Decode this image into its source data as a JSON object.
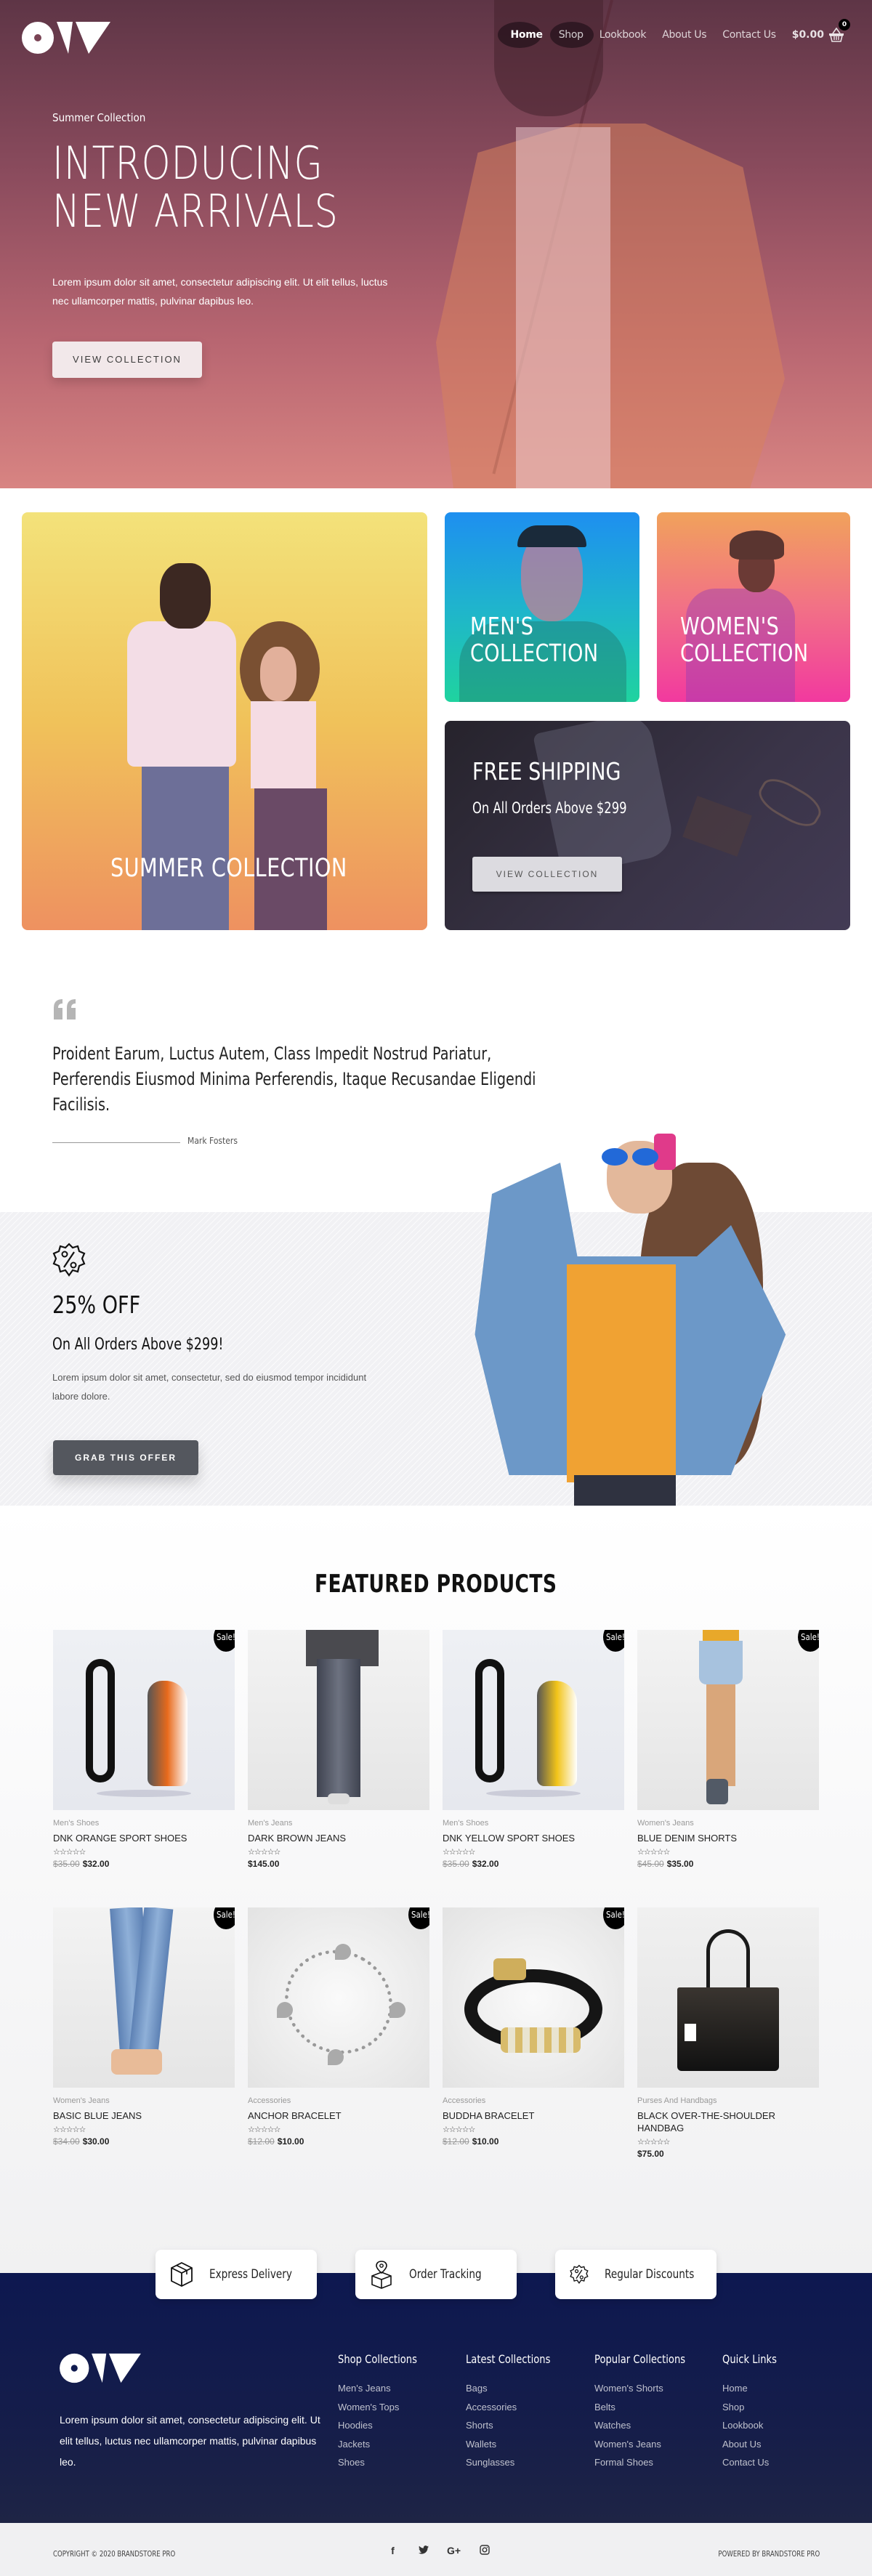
{
  "nav": {
    "logo_alt": "OW",
    "links": [
      {
        "label": "Home",
        "active": true
      },
      {
        "label": "Shop",
        "active": false
      },
      {
        "label": "Lookbook",
        "active": false
      },
      {
        "label": "About Us",
        "active": false
      },
      {
        "label": "Contact Us",
        "active": false
      }
    ],
    "cart_total": "$0.00",
    "cart_count": "0",
    "cart_icon": "basket-icon"
  },
  "hero": {
    "eyebrow": "Summer Collection",
    "title_line1": "INTRODUCING",
    "title_line2": "NEW ARRIVALS",
    "description": "Lorem ipsum dolor sit amet, consectetur adipiscing elit. Ut elit tellus, luctus nec ullamcorper mattis, pulvinar dapibus leo.",
    "button": "VIEW COLLECTION"
  },
  "collections": {
    "summer": "SUMMER COLLECTION",
    "men_line1": "MEN'S",
    "men_line2": "COLLECTION",
    "women_line1": "WOMEN'S",
    "women_line2": "COLLECTION",
    "shipping_title": "FREE SHIPPING",
    "shipping_sub": "On All Orders Above $299",
    "shipping_button": "VIEW COLLECTION"
  },
  "testimonial": {
    "icon": "quote-icon",
    "text": "Proident Earum, Luctus Autem, Class Impedit Nostrud Pariatur, Perferendis Eiusmod Minima Perferendis, Itaque Recusandae Eligendi Facilisis.",
    "author": "Mark Fosters"
  },
  "discount": {
    "icon": "percent-badge-icon",
    "title": "25% OFF",
    "subtitle": "On All Orders Above $299!",
    "description": "Lorem ipsum dolor sit amet, consectetur, sed do eiusmod tempor incididunt labore dolore.",
    "button": "GRAB THIS OFFER"
  },
  "featured": {
    "title": "FEATURED PRODUCTS",
    "sale_label": "Sale!",
    "stars": "☆☆☆☆☆",
    "products": [
      {
        "category": "Men's Shoes",
        "name": "DNK ORANGE SPORT SHOES",
        "old_price": "$35.00",
        "price": "$32.00",
        "sale": true,
        "rating": 0
      },
      {
        "category": "Men's Jeans",
        "name": "DARK BROWN JEANS",
        "old_price": "",
        "price": "$145.00",
        "sale": false,
        "rating": 0
      },
      {
        "category": "Men's Shoes",
        "name": "DNK YELLOW SPORT SHOES",
        "old_price": "$35.00",
        "price": "$32.00",
        "sale": true,
        "rating": 0
      },
      {
        "category": "Women's Jeans",
        "name": "BLUE DENIM SHORTS",
        "old_price": "$45.00",
        "price": "$35.00",
        "sale": true,
        "rating": 0
      },
      {
        "category": "Women's Jeans",
        "name": "BASIC BLUE JEANS",
        "old_price": "$34.00",
        "price": "$30.00",
        "sale": true,
        "rating": 0
      },
      {
        "category": "Accessories",
        "name": "ANCHOR BRACELET",
        "old_price": "$12.00",
        "price": "$10.00",
        "sale": true,
        "rating": 0
      },
      {
        "category": "Accessories",
        "name": "BUDDHA BRACELET",
        "old_price": "$12.00",
        "price": "$10.00",
        "sale": true,
        "rating": 0
      },
      {
        "category": "Purses And Handbags",
        "name": "BLACK OVER-THE-SHOULDER HANDBAG",
        "old_price": "",
        "price": "$75.00",
        "sale": false,
        "rating": 0
      }
    ]
  },
  "features": [
    {
      "icon": "box-icon",
      "label": "Express Delivery"
    },
    {
      "icon": "location-box-icon",
      "label": "Order Tracking"
    },
    {
      "icon": "percent-badge-icon",
      "label": "Regular Discounts"
    }
  ],
  "footer": {
    "description": "Lorem ipsum dolor sit amet, consectetur adipiscing elit. Ut elit tellus, luctus nec ullamcorper mattis, pulvinar dapibus leo.",
    "columns": [
      {
        "title": "Shop Collections",
        "links": [
          "Men's Jeans",
          "Women's Tops",
          "Hoodies",
          "Jackets",
          "Shoes"
        ]
      },
      {
        "title": "Latest Collections",
        "links": [
          "Bags",
          "Accessories",
          "Shorts",
          "Wallets",
          "Sunglasses"
        ]
      },
      {
        "title": "Popular Collections",
        "links": [
          "Women's Shorts",
          "Belts",
          "Watches",
          "Women's Jeans",
          "Formal Shoes"
        ]
      },
      {
        "title": "Quick Links",
        "links": [
          "Home",
          "Shop",
          "Lookbook",
          "About Us",
          "Contact Us"
        ]
      }
    ],
    "copyright": "COPYRIGHT © 2020 BRANDSTORE PRO",
    "powered": "POWERED BY BRANDSTORE PRO",
    "socials": [
      {
        "icon": "facebook-icon",
        "glyph": "f"
      },
      {
        "icon": "twitter-icon",
        "glyph": "🐦"
      },
      {
        "icon": "google-plus-icon",
        "glyph": "G+"
      },
      {
        "icon": "instagram-icon",
        "glyph": "◎"
      }
    ]
  },
  "colors": {
    "footer_bg": "#0d1850",
    "hero_overlay": "#b86671",
    "button_dark": "#54575e",
    "sale_badge": "#000000"
  }
}
